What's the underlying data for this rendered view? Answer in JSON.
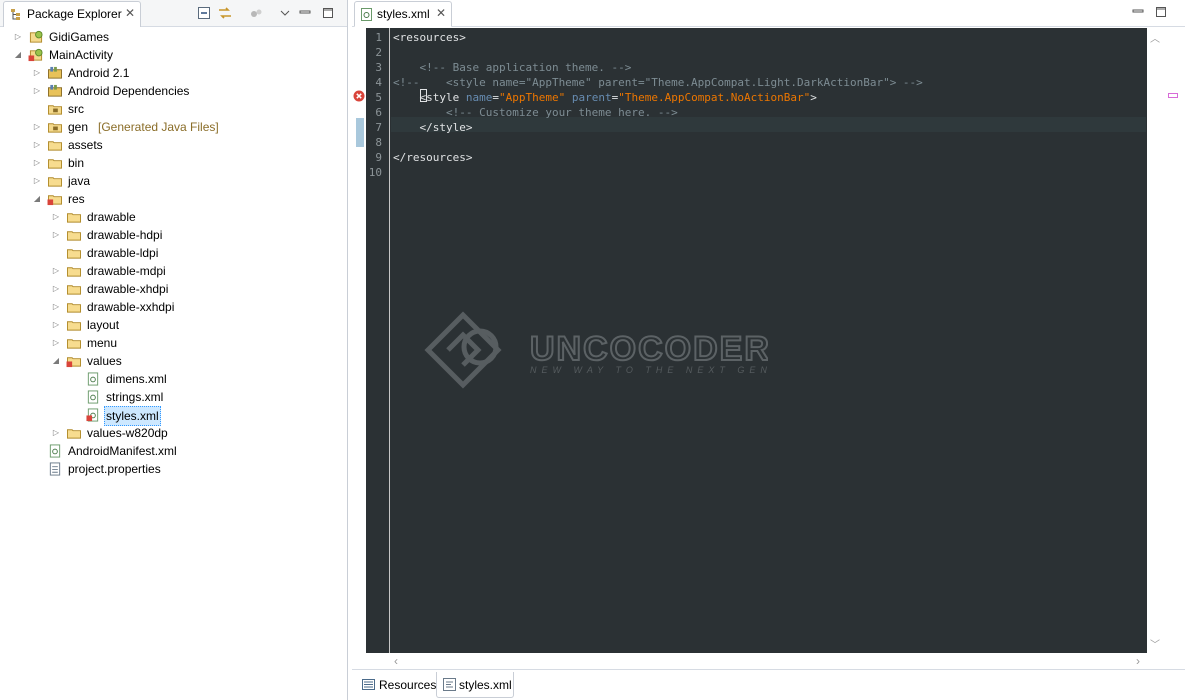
{
  "explorer": {
    "tab_label": "Package Explorer",
    "tree": [
      {
        "label": "GidiGames",
        "indent": 0,
        "arrow": "collapsed",
        "icon": "android-project-icon"
      },
      {
        "label": "MainActivity",
        "indent": 0,
        "arrow": "expanded",
        "icon": "android-project-error-icon"
      },
      {
        "label": "Android 2.1",
        "indent": 1,
        "arrow": "collapsed",
        "icon": "library-icon"
      },
      {
        "label": "Android Dependencies",
        "indent": 1,
        "arrow": "collapsed",
        "icon": "library-icon"
      },
      {
        "label": "src",
        "indent": 1,
        "arrow": "none",
        "icon": "source-folder-icon"
      },
      {
        "label": "gen",
        "decoration": "[Generated Java Files]",
        "indent": 1,
        "arrow": "collapsed",
        "icon": "source-folder-icon"
      },
      {
        "label": "assets",
        "indent": 1,
        "arrow": "collapsed",
        "icon": "folder-icon"
      },
      {
        "label": "bin",
        "indent": 1,
        "arrow": "collapsed",
        "icon": "folder-icon"
      },
      {
        "label": "java",
        "indent": 1,
        "arrow": "collapsed",
        "icon": "folder-icon"
      },
      {
        "label": "res",
        "indent": 1,
        "arrow": "expanded",
        "icon": "folder-error-icon"
      },
      {
        "label": "drawable",
        "indent": 2,
        "arrow": "collapsed",
        "icon": "folder-icon"
      },
      {
        "label": "drawable-hdpi",
        "indent": 2,
        "arrow": "collapsed",
        "icon": "folder-icon"
      },
      {
        "label": "drawable-ldpi",
        "indent": 2,
        "arrow": "none",
        "icon": "folder-icon"
      },
      {
        "label": "drawable-mdpi",
        "indent": 2,
        "arrow": "collapsed",
        "icon": "folder-icon"
      },
      {
        "label": "drawable-xhdpi",
        "indent": 2,
        "arrow": "collapsed",
        "icon": "folder-icon"
      },
      {
        "label": "drawable-xxhdpi",
        "indent": 2,
        "arrow": "collapsed",
        "icon": "folder-icon"
      },
      {
        "label": "layout",
        "indent": 2,
        "arrow": "collapsed",
        "icon": "folder-icon"
      },
      {
        "label": "menu",
        "indent": 2,
        "arrow": "collapsed",
        "icon": "folder-icon"
      },
      {
        "label": "values",
        "indent": 2,
        "arrow": "expanded",
        "icon": "folder-error-icon"
      },
      {
        "label": "dimens.xml",
        "indent": 3,
        "arrow": "none",
        "icon": "xml-file-icon"
      },
      {
        "label": "strings.xml",
        "indent": 3,
        "arrow": "none",
        "icon": "xml-file-icon"
      },
      {
        "label": "styles.xml",
        "indent": 3,
        "arrow": "none",
        "icon": "xml-file-error-icon",
        "selected": true
      },
      {
        "label": "values-w820dp",
        "indent": 2,
        "arrow": "collapsed",
        "icon": "folder-icon"
      },
      {
        "label": "AndroidManifest.xml",
        "indent": 1,
        "arrow": "none",
        "icon": "xml-file-icon"
      },
      {
        "label": "project.properties",
        "indent": 1,
        "arrow": "none",
        "icon": "properties-file-icon"
      }
    ]
  },
  "editor": {
    "tab_label": "styles.xml",
    "lines": [
      {
        "n": "1",
        "parts": [
          [
            "tag",
            "<resources>"
          ]
        ]
      },
      {
        "n": "2",
        "parts": []
      },
      {
        "n": "3",
        "parts": [
          [
            "com",
            "    <!-- Base application theme. -->"
          ]
        ]
      },
      {
        "n": "4",
        "parts": [
          [
            "com",
            "<!--    <style name=\"AppTheme\" parent=\"Theme.AppCompat.Light.DarkActionBar\"> -->"
          ]
        ]
      },
      {
        "n": "5",
        "parts": [
          [
            "tag",
            "    <style "
          ],
          [
            "attr",
            "name"
          ],
          [
            "tag",
            "="
          ],
          [
            "val",
            "\"AppTheme\""
          ],
          [
            "tag",
            " "
          ],
          [
            "attr",
            "parent"
          ],
          [
            "tag",
            "="
          ],
          [
            "val",
            "\"Theme.AppCompat.NoActionBar\""
          ],
          [
            "tag",
            ">"
          ]
        ]
      },
      {
        "n": "6",
        "parts": [
          [
            "com",
            "        <!-- Customize your theme here. -->"
          ]
        ]
      },
      {
        "n": "7",
        "parts": [
          [
            "tag",
            "    </style>"
          ]
        ]
      },
      {
        "n": "8",
        "parts": []
      },
      {
        "n": "9",
        "parts": [
          [
            "tag",
            "</resources>"
          ]
        ]
      },
      {
        "n": "10",
        "parts": []
      }
    ],
    "watermark": {
      "brand": "UNCOCODER",
      "tagline": "NEW WAY TO THE NEXT GEN"
    }
  },
  "bottom_tabs": [
    {
      "label": "Resources",
      "icon": "resources-icon",
      "active": false
    },
    {
      "label": "styles.xml",
      "icon": "xml-source-icon",
      "active": true
    }
  ],
  "colors": {
    "editor_bg": "#2b3134",
    "comment": "#7d8c93",
    "attr": "#678cb1",
    "value": "#ec7600",
    "selection": "#cde8ff"
  }
}
